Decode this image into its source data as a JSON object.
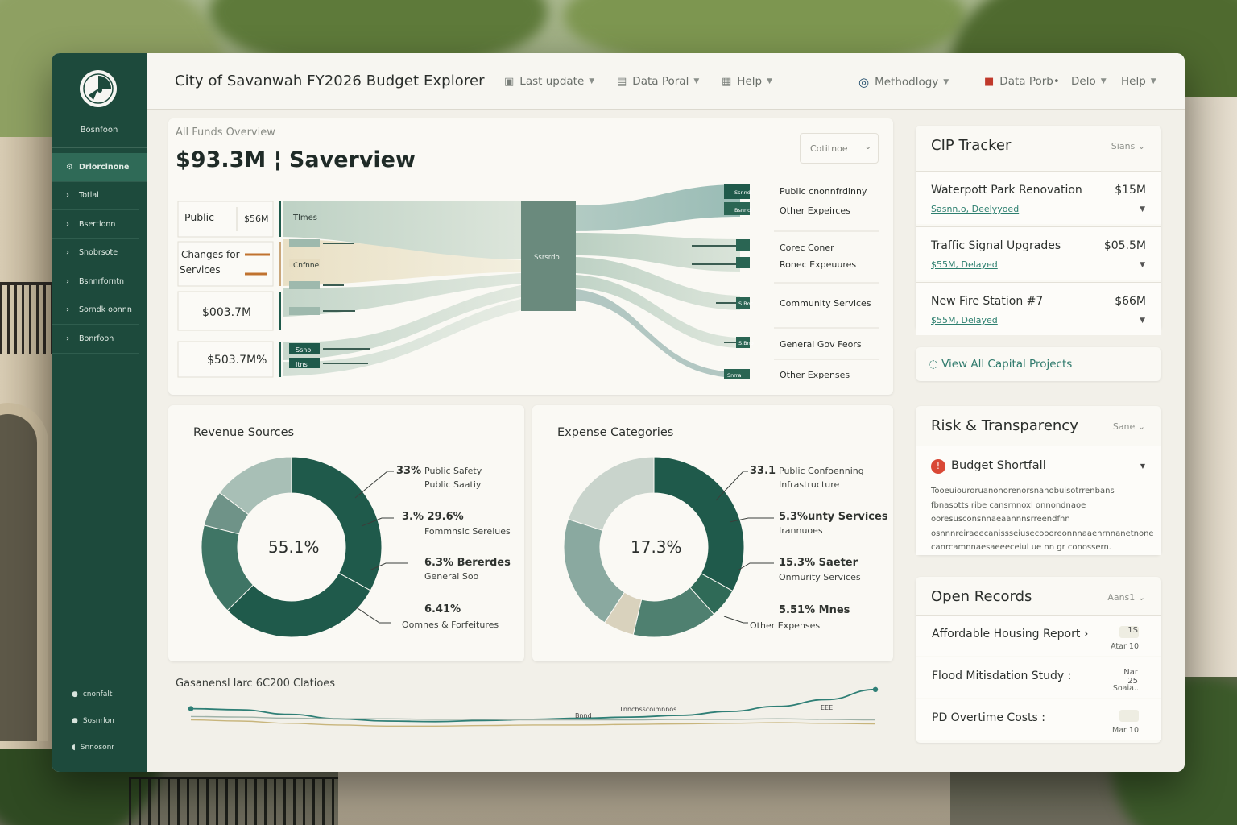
{
  "colors": {
    "sidebar": "#1d4a3c",
    "accent": "#2f7a6c",
    "donut_dark": "#1f5a4b",
    "donut_mid": "#6f9388",
    "donut_light": "#c9d4cc",
    "donut_beige": "#d9d2bd",
    "danger": "#d94836"
  },
  "sidebar": {
    "logo_icon": "city-seal-icon",
    "brand": "Bosnfoon",
    "items": [
      {
        "label": "Drlorclnone",
        "icon": "dashboard-icon",
        "active": true
      },
      {
        "label": "Totlal",
        "icon": "chevron-right-icon"
      },
      {
        "label": "Bsertlonn",
        "icon": "chevron-right-icon"
      },
      {
        "label": "Snobrsote",
        "icon": "chevron-right-icon"
      },
      {
        "label": "Bsnnrforntn",
        "icon": "chevron-right-icon"
      },
      {
        "label": "Sorndk oonnn",
        "icon": "chevron-right-icon"
      },
      {
        "label": "Bonrfoon",
        "icon": "chevron-right-icon"
      }
    ],
    "footer": [
      {
        "label": "cnonfalt",
        "icon": "settings-icon"
      },
      {
        "label": "Sosnrlon",
        "icon": "user-icon"
      },
      {
        "label": "Snnosonr",
        "icon": "logout-icon"
      }
    ]
  },
  "topbar": {
    "title": "City of Savanwah FY2026 Budget Explorer",
    "menus_left": [
      {
        "label": "Last update",
        "icon": "calendar-icon"
      },
      {
        "label": "Data Poral",
        "icon": "database-icon"
      },
      {
        "label": "Help",
        "icon": "help-icon"
      }
    ],
    "menus_right": [
      {
        "label": "Methodlogy",
        "icon": "search-icon"
      },
      {
        "label": "Data Porb•",
        "icon": "gift-icon"
      },
      {
        "label": "Delo",
        "icon": ""
      },
      {
        "label": "Help",
        "icon": ""
      }
    ]
  },
  "flow": {
    "subtitle": "All Funds Overview",
    "title": "$93.3M ¦ Saverview",
    "select": "Cotitnoe",
    "center_label": "Ssrsrdo",
    "sources": [
      {
        "label": "Public",
        "value": "$56M"
      },
      {
        "label": "Changes for Services",
        "value": ""
      },
      {
        "label": "",
        "value": "$003.7M"
      },
      {
        "label": "",
        "value": "$503.7M%"
      }
    ],
    "source_bands": [
      "Tlmes",
      "Cnfnne",
      "Cntinoe",
      "Cntnos",
      "",
      "Ssno",
      "Itns"
    ],
    "targets": [
      {
        "label": "Public cnonnfrdinny",
        "tag": "Ssnnd"
      },
      {
        "label": "Other Expeirces",
        "tag": "Bsnnd"
      },
      {
        "label": "Corec Coner",
        "tag": "Bnns"
      },
      {
        "label": "Ronec Expeuures",
        "tag": "Bsna"
      },
      {
        "label": "Community Services",
        "tag": "S.Boc"
      },
      {
        "label": "General Gov  Feors",
        "tag": "S.Bno"
      },
      {
        "label": "Other Expenses",
        "tag": "Snrra"
      }
    ]
  },
  "revenue": {
    "title": "Revenue Sources",
    "center": "55.1%",
    "labels": [
      {
        "pct": "33%",
        "line1": "Public Safety",
        "line2": "Public Saatiy"
      },
      {
        "pct": "3.% 29.6%",
        "line1": "Fommnsic Sereiues",
        "line2": ""
      },
      {
        "pct": "6.3% Bererdes",
        "line1": "General Soo",
        "line2": ""
      },
      {
        "pct": "6.41%",
        "line1": "Oomnes & Forfeitures",
        "line2": ""
      }
    ],
    "slices": [
      33,
      29.6,
      16.3,
      6.41,
      14.69
    ]
  },
  "expense": {
    "title": "Expense Categories",
    "center": "17.3%",
    "labels": [
      {
        "pct": "33.1",
        "line1": "Public Confoenning",
        "line2": "Infrastructure"
      },
      {
        "pct": "5.3%unty Services",
        "line1": "Irannuoes",
        "line2": ""
      },
      {
        "pct": "15.3% Saeter",
        "line1": "Onmurity Services",
        "line2": ""
      },
      {
        "pct": "5.51% Mnes",
        "line1": "Other  Expenses",
        "line2": ""
      }
    ],
    "slices": [
      33.1,
      5.3,
      15.3,
      5.51,
      20.79,
      20
    ]
  },
  "trend": {
    "title": "Gasanensl larc 6C200 Clatioes",
    "annotations": [
      "Bnnd",
      "Tnnchsscoimnnos",
      "EEE"
    ],
    "series": [
      {
        "name": "",
        "values": [
          62,
          60,
          52,
          44,
          40,
          39,
          41,
          43,
          45,
          47,
          50,
          57,
          66,
          78,
          96
        ]
      },
      {
        "name": "",
        "values": [
          42,
          40,
          36,
          33,
          31,
          31,
          32,
          33,
          33,
          34,
          35,
          36,
          37,
          36,
          35
        ]
      },
      {
        "name": "",
        "values": [
          48,
          47,
          45,
          44,
          44,
          43,
          43,
          42,
          42,
          42,
          43,
          43,
          44,
          43,
          42
        ]
      }
    ]
  },
  "cip": {
    "title": "CIP Tracker",
    "sort": "Sians",
    "items": [
      {
        "name": "Waterpott Park Renovation",
        "amount": "$15M",
        "status": "Sasnn.o, Deelyyoed"
      },
      {
        "name": "Traffic Signal Upgrades",
        "amount": "$05.5M",
        "status": "$55M, Delayed"
      },
      {
        "name": "New Fire Station #7",
        "amount": "$66M",
        "status": "$55M, Delayed"
      }
    ],
    "link": "View All Capital Projects"
  },
  "risk": {
    "title": "Risk & Transparency",
    "sort": "Sane",
    "head": "Budget Shortfall",
    "text": "Tooeuiouroruanonorenorsnanobuisotrrenbans fbnasotts ribe cansrnnoxl onnondnaoe ooresusconsnnaeaannnsrreendfnn osnnnreiraeecanissseiusecoooreonnnaaenrnnanetnone canrcamnnaesaeeeceiul ue nn gr conossern."
  },
  "records": {
    "title": "Open Records",
    "sort": "Aans1 ",
    "items": [
      {
        "name": "Affordable Housing Report ›",
        "badge": "1S",
        "date": "Atar 10"
      },
      {
        "name": "Flood Mitisdation Study :",
        "badge": "Nar 25",
        "date": "Soaia.."
      },
      {
        "name": "PD Overtime Costs :",
        "badge": "",
        "date": "Mar 10"
      }
    ]
  }
}
